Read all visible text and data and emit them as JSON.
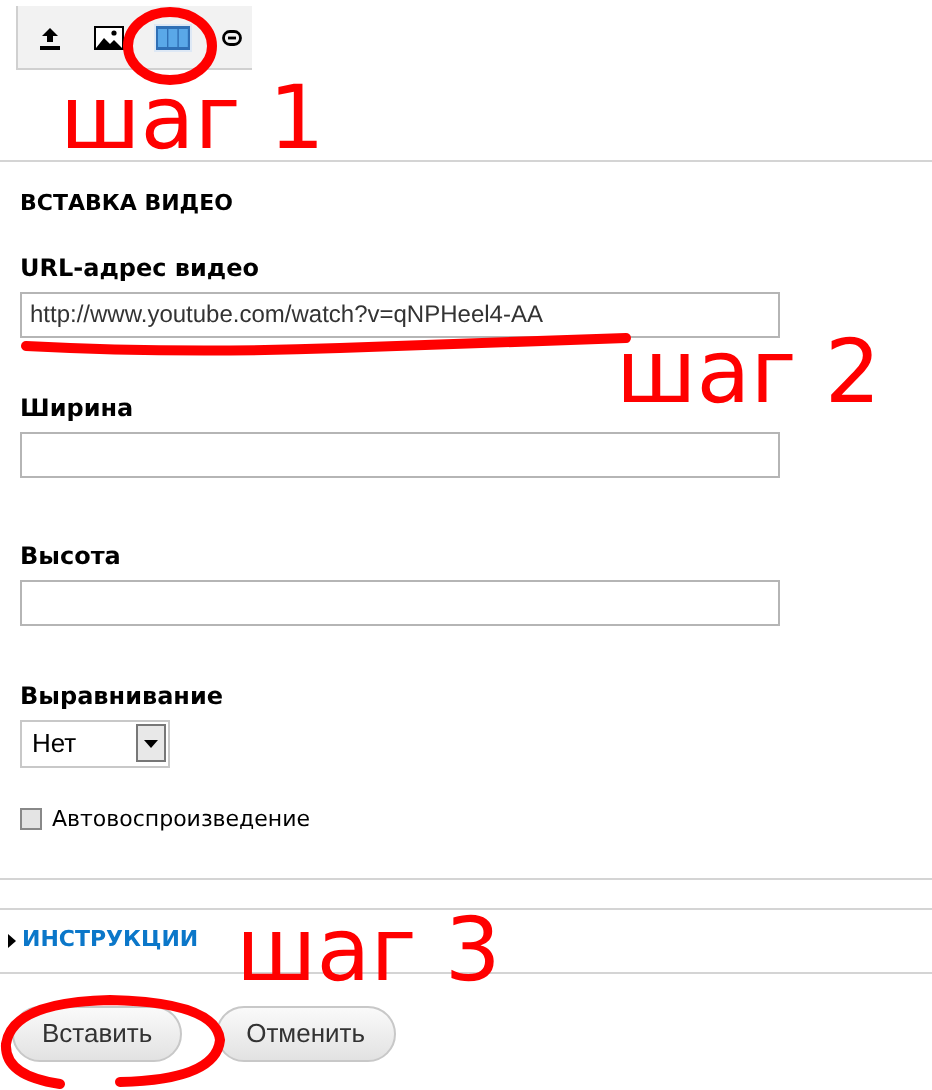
{
  "toolbar": [
    {
      "kind": "upload",
      "selected": false
    },
    {
      "kind": "image",
      "selected": false
    },
    {
      "kind": "video",
      "selected": true
    },
    {
      "kind": "link",
      "selected": false
    }
  ],
  "section_title": "ВСТАВКА ВИДЕО",
  "fields": [
    {
      "label": "URL-адрес видео",
      "value": "http://www.youtube.com/watch?v=qNPHeel4-AA"
    },
    {
      "label": "Ширина"
    },
    {
      "label": "Высота"
    }
  ],
  "alignment": {
    "label": "Выравнивание",
    "value": "Нет"
  },
  "autoplay": {
    "label": "Автовоспроизведение",
    "checked": false
  },
  "instructions": {
    "label": "ИНСТРУКЦИИ"
  },
  "buttons": [
    {
      "label": "Вставить"
    },
    {
      "label": "Отменить"
    }
  ],
  "steps": [
    "шаг 1",
    "шаг 2",
    "шаг 3"
  ]
}
